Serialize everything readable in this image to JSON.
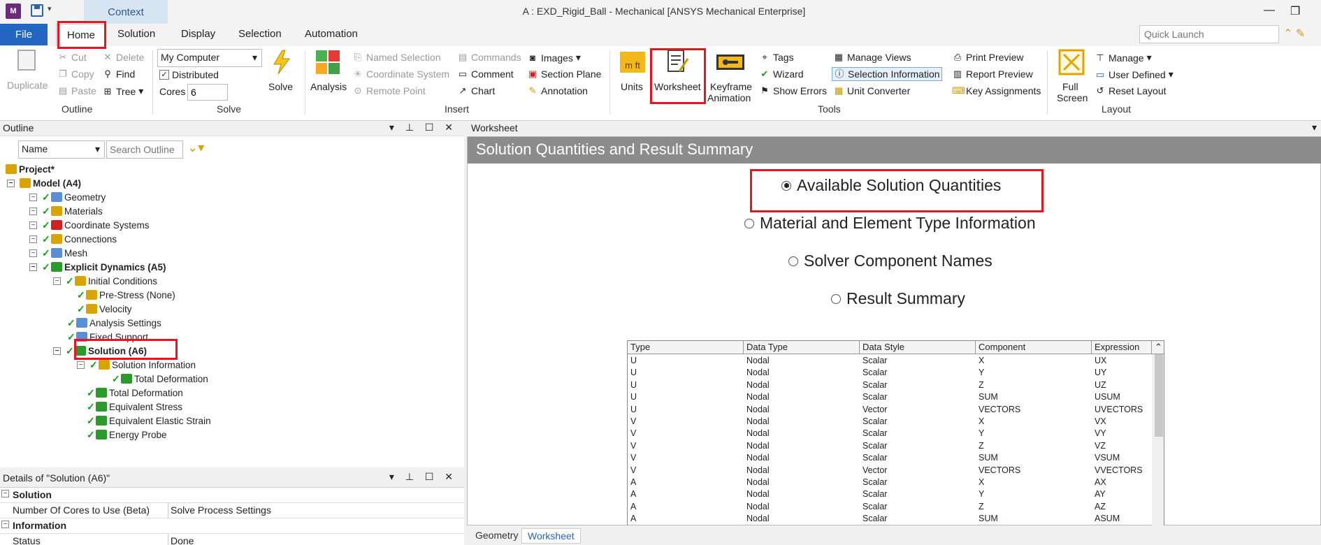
{
  "window": {
    "title": "A : EXD_Rigid_Ball - Mechanical [ANSYS Mechanical Enterprise]",
    "app_icon": "M",
    "context_tab": "Context"
  },
  "tabs": {
    "file": "File",
    "home": "Home",
    "solution": "Solution",
    "display": "Display",
    "selection": "Selection",
    "automation": "Automation"
  },
  "quick_launch_placeholder": "Quick Launch",
  "ribbon": {
    "outline": {
      "duplicate": "Duplicate",
      "cut": "Cut",
      "copy": "Copy",
      "paste": "Paste",
      "delete": "Delete",
      "find": "Find",
      "tree": "Tree",
      "label": "Outline"
    },
    "solve": {
      "computer": "My Computer",
      "distributed": "Distributed",
      "cores_label": "Cores",
      "cores_value": "6",
      "solve": "Solve",
      "label": "Solve"
    },
    "insert": {
      "analysis": "Analysis",
      "named_selection": "Named Selection",
      "coordinate_system": "Coordinate System",
      "remote_point": "Remote Point",
      "commands": "Commands",
      "comment": "Comment",
      "chart": "Chart",
      "images": "Images",
      "section_plane": "Section Plane",
      "annotation": "Annotation",
      "label": "Insert"
    },
    "tools": {
      "units": "Units",
      "worksheet": "Worksheet",
      "keyframe": "Keyframe",
      "animation": "Animation",
      "tags": "Tags",
      "wizard": "Wizard",
      "show_errors": "Show Errors",
      "manage_views": "Manage Views",
      "selection_information": "Selection Information",
      "unit_converter": "Unit Converter",
      "print_preview": "Print Preview",
      "report_preview": "Report Preview",
      "key_assignments": "Key Assignments",
      "label": "Tools"
    },
    "layout": {
      "full": "Full",
      "screen": "Screen",
      "manage": "Manage",
      "user_defined": "User Defined",
      "reset_layout": "Reset Layout",
      "label": "Layout"
    }
  },
  "outline": {
    "title": "Outline",
    "filter": "Name",
    "search_placeholder": "Search Outline",
    "tree": [
      {
        "label": "Project*",
        "bold": true
      },
      {
        "label": "Model (A4)",
        "bold": true
      },
      {
        "label": "Geometry"
      },
      {
        "label": "Materials"
      },
      {
        "label": "Coordinate Systems"
      },
      {
        "label": "Connections"
      },
      {
        "label": "Mesh"
      },
      {
        "label": "Explicit Dynamics (A5)",
        "bold": true
      },
      {
        "label": "Initial Conditions"
      },
      {
        "label": "Pre-Stress (None)"
      },
      {
        "label": "Velocity"
      },
      {
        "label": "Analysis Settings"
      },
      {
        "label": "Fixed Support"
      },
      {
        "label": "Solution (A6)",
        "bold": true
      },
      {
        "label": "Solution Information"
      },
      {
        "label": "Total Deformation"
      },
      {
        "label": "Total Deformation"
      },
      {
        "label": "Equivalent Stress"
      },
      {
        "label": "Equivalent Elastic Strain"
      },
      {
        "label": "Energy Probe"
      }
    ]
  },
  "details": {
    "title": "Details of \"Solution (A6)\"",
    "section_solution": "Solution",
    "cores_label": "Number Of Cores to Use (Beta)",
    "cores_value": "Solve Process Settings",
    "section_information": "Information",
    "status_label": "Status",
    "status_value": "Done"
  },
  "worksheet": {
    "panel_title": "Worksheet",
    "title": "Solution Quantities and Result Summary",
    "options": [
      "Available Solution Quantities",
      "Material and Element Type Information",
      "Solver Component Names",
      "Result Summary"
    ],
    "table": {
      "headers": [
        "Type",
        "Data Type",
        "Data Style",
        "Component",
        "Expression"
      ],
      "rows": [
        [
          "U",
          "Nodal",
          "Scalar",
          "X",
          "UX"
        ],
        [
          "U",
          "Nodal",
          "Scalar",
          "Y",
          "UY"
        ],
        [
          "U",
          "Nodal",
          "Scalar",
          "Z",
          "UZ"
        ],
        [
          "U",
          "Nodal",
          "Scalar",
          "SUM",
          "USUM"
        ],
        [
          "U",
          "Nodal",
          "Vector",
          "VECTORS",
          "UVECTORS"
        ],
        [
          "V",
          "Nodal",
          "Scalar",
          "X",
          "VX"
        ],
        [
          "V",
          "Nodal",
          "Scalar",
          "Y",
          "VY"
        ],
        [
          "V",
          "Nodal",
          "Scalar",
          "Z",
          "VZ"
        ],
        [
          "V",
          "Nodal",
          "Scalar",
          "SUM",
          "VSUM"
        ],
        [
          "V",
          "Nodal",
          "Vector",
          "VECTORS",
          "VVECTORS"
        ],
        [
          "A",
          "Nodal",
          "Scalar",
          "X",
          "AX"
        ],
        [
          "A",
          "Nodal",
          "Scalar",
          "Y",
          "AY"
        ],
        [
          "A",
          "Nodal",
          "Scalar",
          "Z",
          "AZ"
        ],
        [
          "A",
          "Nodal",
          "Scalar",
          "SUM",
          "ASUM"
        ]
      ]
    }
  },
  "bottom_tabs": {
    "geometry": "Geometry",
    "worksheet": "Worksheet"
  }
}
